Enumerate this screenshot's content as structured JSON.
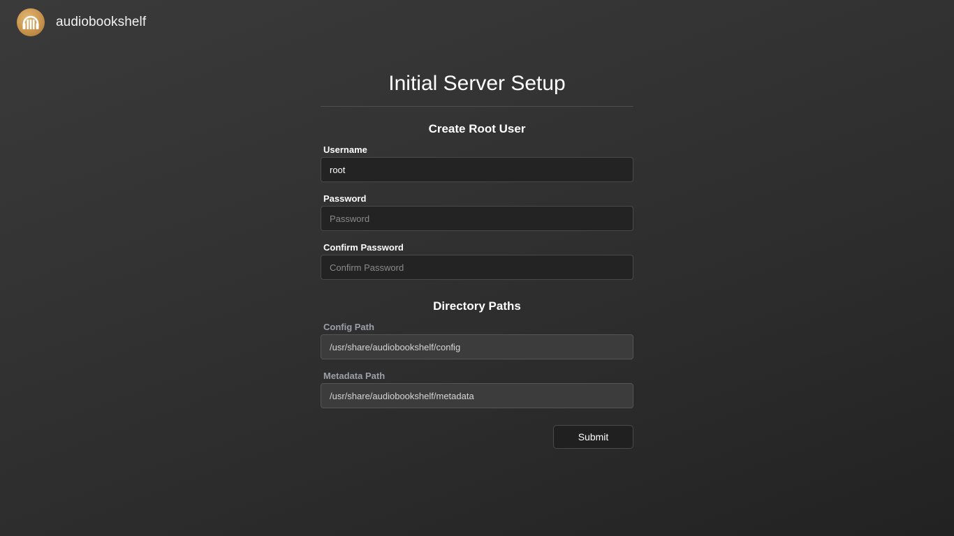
{
  "brand": {
    "name": "audiobookshelf",
    "logo_icon": "audiobookshelf-logo-icon",
    "logo_color": "#c8934a"
  },
  "page": {
    "title": "Initial Server Setup"
  },
  "root_user": {
    "section_title": "Create Root User",
    "username": {
      "label": "Username",
      "value": "root",
      "placeholder": ""
    },
    "password": {
      "label": "Password",
      "value": "",
      "placeholder": "Password"
    },
    "confirm_password": {
      "label": "Confirm Password",
      "value": "",
      "placeholder": "Confirm Password"
    }
  },
  "directories": {
    "section_title": "Directory Paths",
    "config_path": {
      "label": "Config Path",
      "value": "/usr/share/audiobookshelf/config"
    },
    "metadata_path": {
      "label": "Metadata Path",
      "value": "/usr/share/audiobookshelf/metadata"
    }
  },
  "actions": {
    "submit_label": "Submit"
  }
}
